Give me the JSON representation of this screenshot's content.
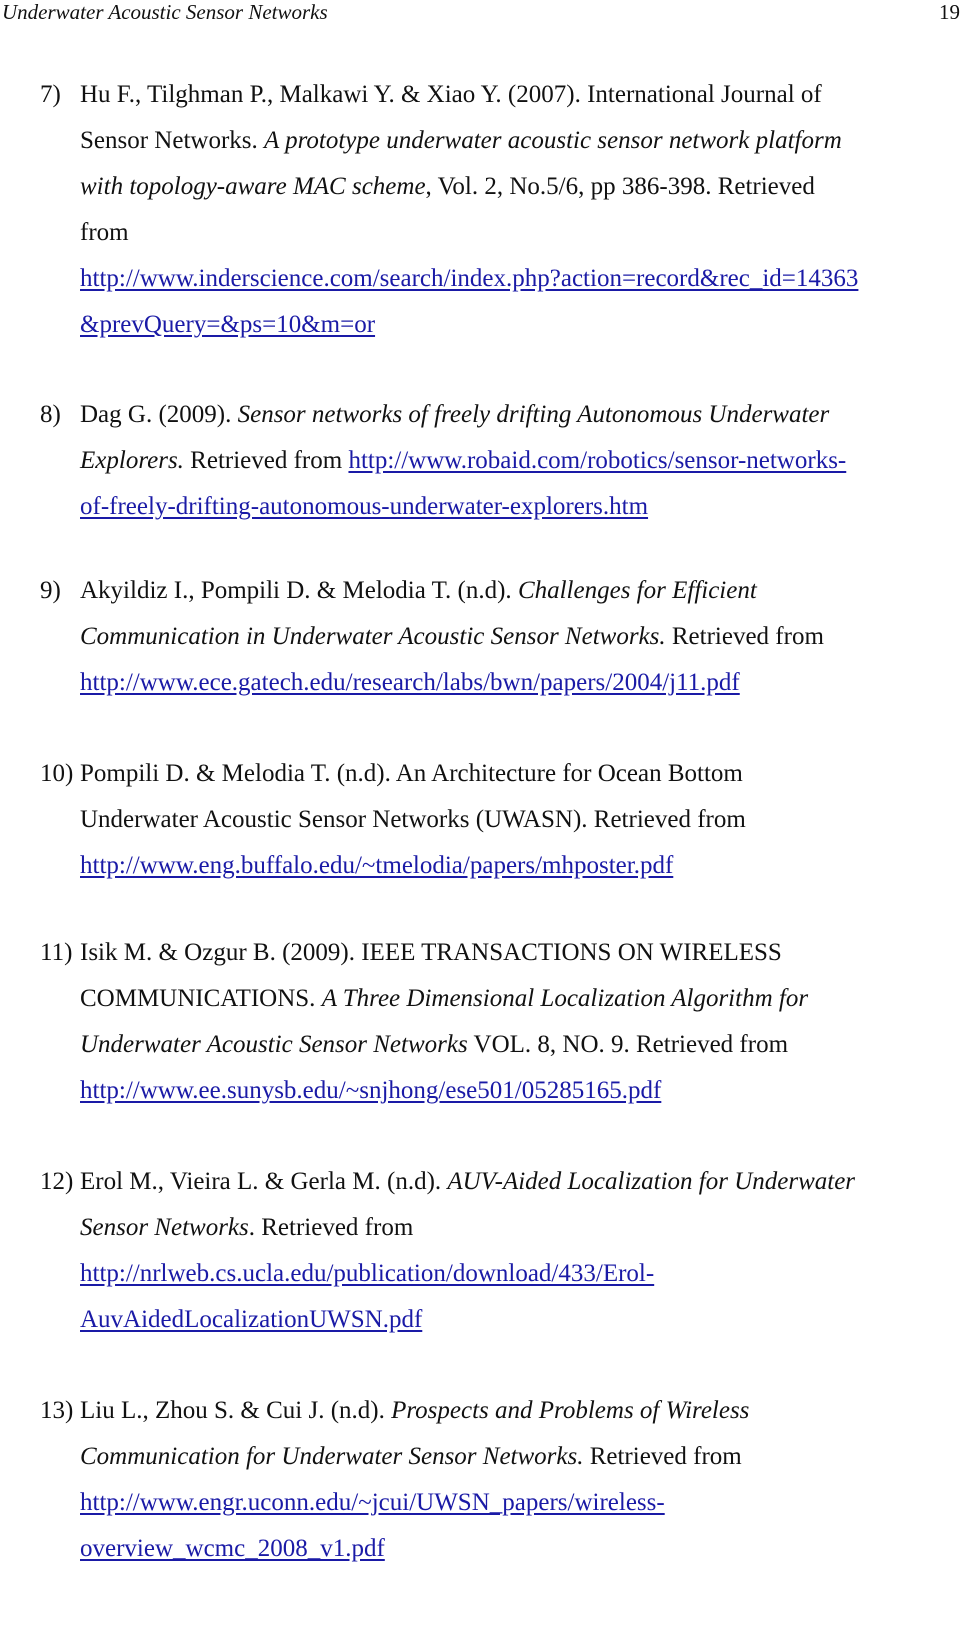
{
  "header": {
    "title": "Underwater Acoustic Sensor Networks",
    "page_number": "19"
  },
  "link_color": "#1a1aa6",
  "references": [
    {
      "number": "7)",
      "lines": [
        [
          {
            "t": "Hu F., Tilghman P., Malkawi Y. & Xiao Y. (2007). International Journal of"
          }
        ],
        [
          {
            "t": "Sensor Networks. "
          },
          {
            "t": "A prototype underwater acoustic sensor network platform",
            "i": true
          }
        ],
        [
          {
            "t": "with topology-aware MAC  scheme",
            "i": true
          },
          {
            "t": ", Vol. 2, No.5/6, pp 386-398. Retrieved"
          }
        ],
        [
          {
            "t": "from"
          }
        ],
        [
          {
            "t": "http://www.inderscience.com/search/index.php?action=record&rec_id=14363",
            "l": true
          }
        ],
        [
          {
            "t": "&prevQuery=&ps=10&m=or",
            "l": true
          }
        ]
      ]
    },
    {
      "number": "8)",
      "lines": [
        [
          {
            "t": "Dag G. (2009). "
          },
          {
            "t": "Sensor networks of freely drifting Autonomous Underwater",
            "i": true
          }
        ],
        [
          {
            "t": "Explorers.",
            "i": true
          },
          {
            "t": " Retrieved from "
          },
          {
            "t": "http://www.robaid.com/robotics/sensor-networks-",
            "l": true
          }
        ],
        [
          {
            "t": "of-freely-drifting-autonomous-underwater-explorers.htm",
            "l": true
          }
        ]
      ]
    },
    {
      "number": "9)",
      "lines": [
        [
          {
            "t": "Akyildiz I., Pompili D. & Melodia T. (n.d). "
          },
          {
            "t": "Challenges for Efficient",
            "i": true
          }
        ],
        [
          {
            "t": "Communication in Underwater Acoustic Sensor Networks.",
            "i": true
          },
          {
            "t": " Retrieved from"
          }
        ],
        [
          {
            "t": "http://www.ece.gatech.edu/research/labs/bwn/papers/2004/j11.pdf",
            "l": true
          }
        ]
      ]
    },
    {
      "number": "10)",
      "lines": [
        [
          {
            "t": "Pompili D. & Melodia T. (n.d). An Architecture for Ocean Bottom"
          }
        ],
        [
          {
            "t": "Underwater Acoustic Sensor Networks (UWASN). Retrieved from"
          }
        ],
        [
          {
            "t": "http://www.eng.buffalo.edu/~tmelodia/papers/mhposter.pdf",
            "l": true
          }
        ]
      ]
    },
    {
      "number": "11)",
      "lines": [
        [
          {
            "t": "Isik M. & Ozgur B. (2009). IEEE TRANSACTIONS ON WIRELESS"
          }
        ],
        [
          {
            "t": "COMMUNICATIONS. "
          },
          {
            "t": "A Three Dimensional Localization Algorithm for",
            "i": true
          }
        ],
        [
          {
            "t": "Underwater Acoustic Sensor Networks",
            "i": true
          },
          {
            "t": " VOL. 8, NO. 9. Retrieved from"
          }
        ],
        [
          {
            "t": "http://www.ee.sunysb.edu/~snjhong/ese501/05285165.pdf",
            "l": true
          }
        ]
      ]
    },
    {
      "number": "12)",
      "lines": [
        [
          {
            "t": "Erol M., Vieira L. & Gerla M. (n.d). "
          },
          {
            "t": "AUV-Aided Localization for Underwater",
            "i": true
          }
        ],
        [
          {
            "t": "Sensor Networks",
            "i": true
          },
          {
            "t": ". Retrieved from"
          }
        ],
        [
          {
            "t": "http://nrlweb.cs.ucla.edu/publication/download/433/Erol-",
            "l": true
          }
        ],
        [
          {
            "t": "AuvAidedLocalizationUWSN.pdf",
            "l": true
          }
        ]
      ]
    },
    {
      "number": "13)",
      "lines": [
        [
          {
            "t": "Liu L., Zhou S. & Cui J. (n.d). "
          },
          {
            "t": "Prospects and Problems of Wireless",
            "i": true
          }
        ],
        [
          {
            "t": "Communication for Underwater Sensor Networks.",
            "i": true
          },
          {
            "t": " Retrieved from"
          }
        ],
        [
          {
            "t": "http://www.engr.uconn.edu/~jcui/UWSN_papers/wireless-",
            "l": true
          }
        ],
        [
          {
            "t": "overview_wcmc_2008_v1.pdf",
            "l": true
          }
        ]
      ]
    }
  ]
}
